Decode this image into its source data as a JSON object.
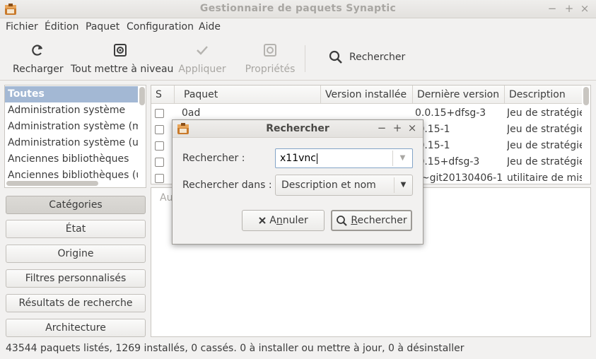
{
  "window": {
    "title": "Gestionnaire de paquets Synaptic",
    "controls": {
      "minimize": "−",
      "maximize": "+",
      "close": "×"
    }
  },
  "menu": [
    "Fichier",
    "Édition",
    "Paquet",
    "Configuration",
    "Aide"
  ],
  "toolbar": {
    "reload": "Recharger",
    "upgrade_all": "Tout mettre à niveau",
    "apply": "Appliquer",
    "properties": "Propriétés",
    "search": "Rechercher"
  },
  "categories": {
    "items": [
      "Toutes",
      "Administration système",
      "Administration système (m",
      "Administration système (ur",
      "Anciennes bibliothèques",
      "Anciennes bibliothèques (ur"
    ],
    "selected_index": 0
  },
  "filters": {
    "buttons": [
      "Catégories",
      "État",
      "Origine",
      "Filtres personnalisés",
      "Résultats de recherche",
      "Architecture"
    ],
    "active_index": 0
  },
  "packages": {
    "columns": [
      "S",
      "Paquet",
      "Version installée",
      "Dernière version",
      "Description"
    ],
    "rows": [
      {
        "name": "0ad",
        "installed": "",
        "latest": "0.0.15+dfsg-3",
        "description": "Jeu de stratégie"
      },
      {
        "name": "",
        "installed": "",
        "latest": ".0.15-1",
        "description": "Jeu de stratégie"
      },
      {
        "name": "",
        "installed": "",
        "latest": ".0.15-1",
        "description": "Jeu de stratégie"
      },
      {
        "name": "",
        "installed": "",
        "latest": ".0.15+dfsg-3",
        "description": "Jeu de stratégie"
      },
      {
        "name": "",
        "installed": "",
        "latest": "6~git20130406-1",
        "description": "utilitaire de mis"
      }
    ]
  },
  "description_pane": {
    "stub": "Au"
  },
  "status": "43544 paquets listés, 1269 installés, 0 cassés. 0 à installer ou mettre à jour, 0 à désinstaller",
  "dialog": {
    "title": "Rechercher",
    "controls": {
      "minimize": "−",
      "maximize": "+",
      "close": "×"
    },
    "search_label": "Rechercher :",
    "search_value": "x11vnc",
    "search_in_label": "Rechercher dans :",
    "search_in_value": "Description et nom",
    "cancel_pre": "A",
    "cancel_mnemonic": "n",
    "cancel_post": "nuler",
    "ok_mnemonic": "R",
    "ok_post": "echercher"
  },
  "colors": {
    "selection": "#a3b8d4",
    "window_bg": "#f2f1f0",
    "input_focus": "#83a4c7"
  }
}
